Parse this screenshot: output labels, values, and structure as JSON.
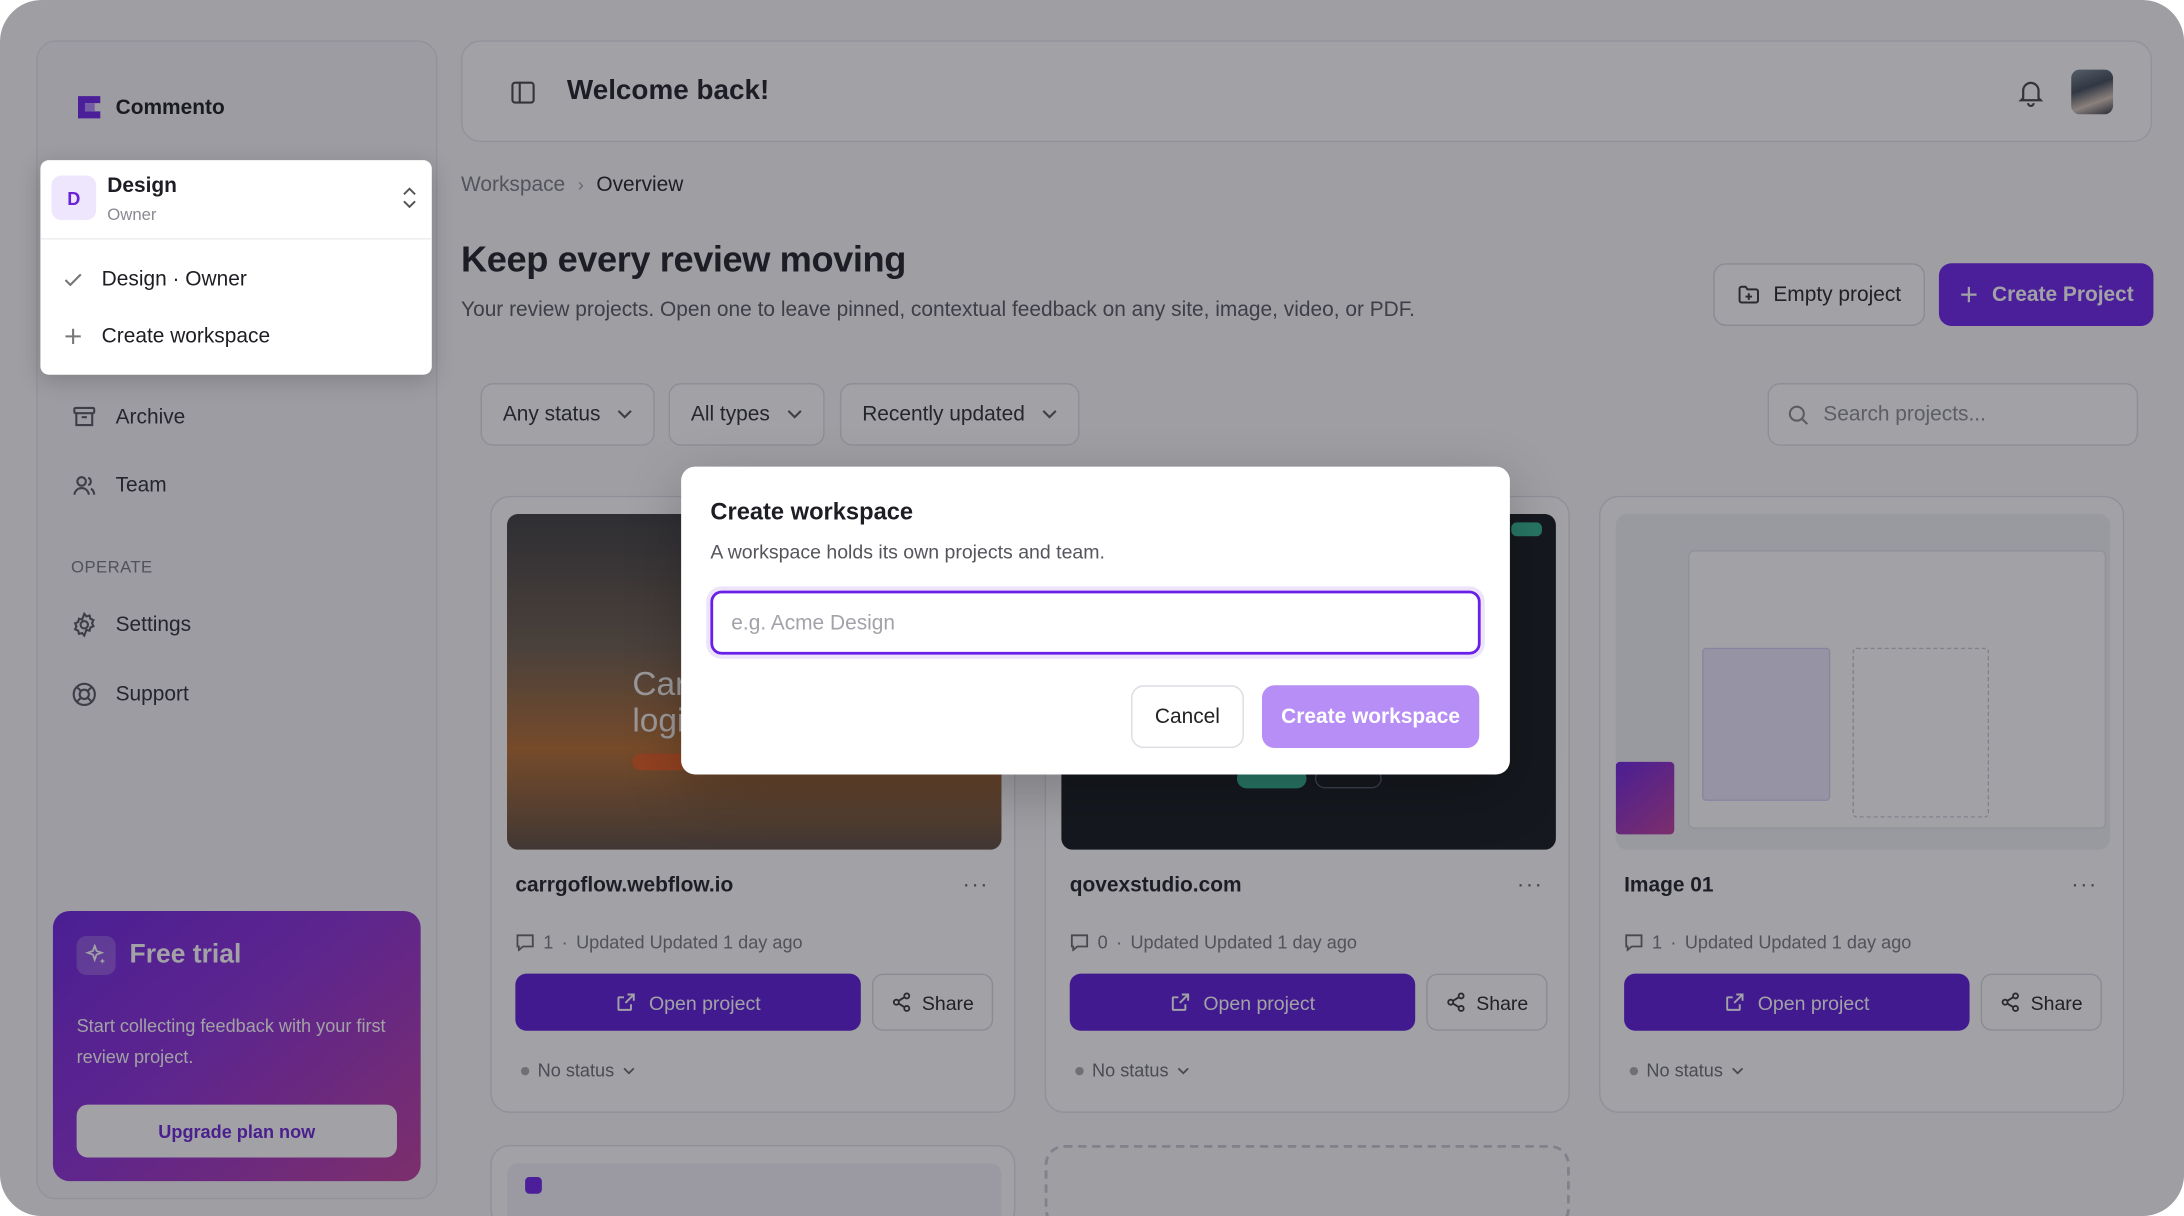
{
  "app": {
    "name": "Commento"
  },
  "workspace": {
    "badge": "D",
    "name": "Design",
    "role": "Owner",
    "options": [
      {
        "label": "Design · Owner",
        "icon": "check-icon"
      },
      {
        "label": "Create workspace",
        "icon": "plus-icon"
      }
    ]
  },
  "sidebar": {
    "items": [
      {
        "label": "Archive",
        "icon": "archive-icon"
      },
      {
        "label": "Team",
        "icon": "users-icon"
      }
    ],
    "section_operate": "OPERATE",
    "operate_items": [
      {
        "label": "Settings",
        "icon": "gear-icon"
      },
      {
        "label": "Support",
        "icon": "lifebuoy-icon"
      }
    ]
  },
  "trial": {
    "title": "Free trial",
    "description": "Start collecting feedback with your first review project.",
    "button": "Upgrade plan now"
  },
  "topbar": {
    "title": "Welcome back!"
  },
  "breadcrumb": {
    "parent": "Workspace",
    "separator": "›",
    "current": "Overview"
  },
  "page": {
    "title": "Keep every review moving",
    "subtitle": "Your review projects. Open one to leave pinned, contextual feedback on any site, image, video, or PDF.",
    "empty_project": "Empty project",
    "create_project": "Create Project"
  },
  "filters": {
    "status": "Any status",
    "types": "All types",
    "sort": "Recently updated",
    "search_placeholder": "Search projects..."
  },
  "projects": [
    {
      "name": "carrgoflow.webflow.io",
      "comments": "1",
      "updated": "Updated Updated 1 day ago",
      "open": "Open project",
      "share": "Share",
      "status": "No status"
    },
    {
      "name": "qovexstudio.com",
      "comments": "0",
      "updated": "Updated Updated 1 day ago",
      "open": "Open project",
      "share": "Share",
      "status": "No status"
    },
    {
      "name": "Image 01",
      "comments": "1",
      "updated": "Updated Updated 1 day ago",
      "open": "Open project",
      "share": "Share",
      "status": "No status"
    }
  ],
  "modal": {
    "title": "Create workspace",
    "description": "A workspace holds its own projects and team.",
    "input_placeholder": "e.g. Acme Design",
    "input_value": "",
    "cancel": "Cancel",
    "submit": "Create workspace"
  },
  "colors": {
    "brand": "#6a1fe8",
    "brand_disabled": "#b78ef5",
    "overlay": "rgba(32,32,42,0.42)"
  }
}
